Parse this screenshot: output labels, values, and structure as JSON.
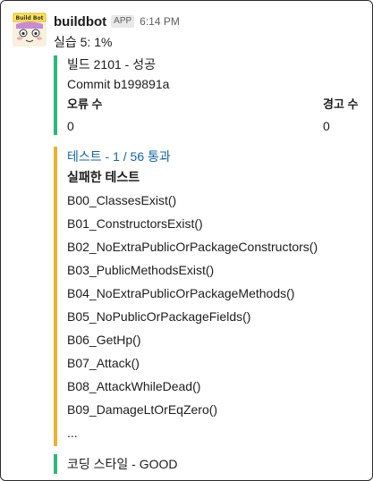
{
  "colors": {
    "success_bar": "#2eb67d",
    "warning_bar": "#ecb22e",
    "link_blue": "#1264a3"
  },
  "message": {
    "username": "buildbot",
    "app_badge": "APP",
    "timestamp": "6:14 PM",
    "text": "실습 5: 1%",
    "avatar_text": "Build Bot"
  },
  "build": {
    "title": "빌드 2101 - 성공",
    "commit": "Commit b199891a",
    "fields": [
      {
        "title": "오류 수",
        "value": "0"
      },
      {
        "title": "경고 수",
        "value": "0"
      }
    ]
  },
  "tests": {
    "title": "테스트 - 1 / 56 통과",
    "heading": "실패한 테스트",
    "items": [
      "B00_ClassesExist()",
      "B01_ConstructorsExist()",
      "B02_NoExtraPublicOrPackageConstructors()",
      "B03_PublicMethodsExist()",
      "B04_NoExtraPublicOrPackageMethods()",
      "B05_NoPublicOrPackageFields()",
      "B06_GetHp()",
      "B07_Attack()",
      "B08_AttackWhileDead()",
      "B09_DamageLtOrEqZero()",
      "..."
    ]
  },
  "style": {
    "text": "코딩 스타일 - GOOD"
  }
}
